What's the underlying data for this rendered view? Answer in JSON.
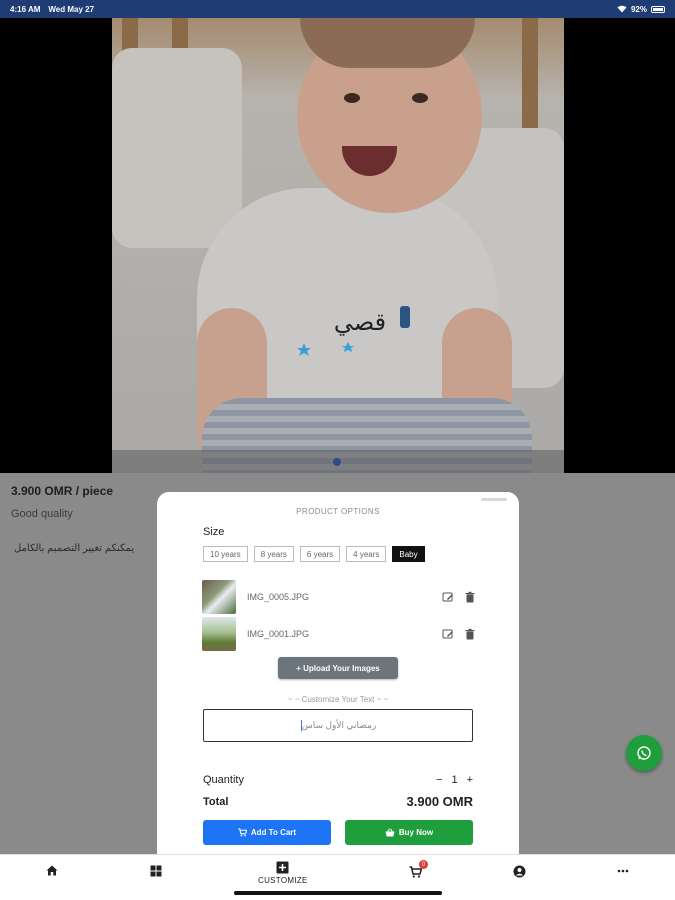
{
  "status_bar": {
    "time": "4:16 AM",
    "date": "Wed May 27",
    "battery": "92%"
  },
  "product": {
    "price": "3.900 OMR / piece",
    "quality": "Good quality",
    "note_arabic": "يمكنكم تغيير التصميم بالكامل",
    "image_text_arabic": "قصي"
  },
  "modal": {
    "title": "PRODUCT OPTIONS",
    "size_label": "Size",
    "sizes": [
      "10 years",
      "8 years",
      "6 years",
      "4 years",
      "Baby"
    ],
    "selected_size": "Baby",
    "files": [
      {
        "name": "IMG_0005.JPG"
      },
      {
        "name": "IMG_0001.JPG"
      }
    ],
    "upload_label": "+ Upload Your Images",
    "customize_label": "~ ~ Customize Your Text ~ ~",
    "custom_text_value": "رمضاني الأول ساس",
    "quantity_label": "Quantity",
    "quantity_minus": "−",
    "quantity_value": "1",
    "quantity_plus": "+",
    "total_label": "Total",
    "total_value": "3.900 OMR",
    "add_to_cart": "Add To Cart",
    "buy_now": "Buy Now"
  },
  "bottom_nav": {
    "customize_label": "CUSTOMIZE",
    "cart_badge": "0"
  },
  "colors": {
    "status_bar": "#1f3d74",
    "add_to_cart": "#1d74f5",
    "buy_now": "#1e9e3d",
    "whatsapp": "#1e9e3d"
  }
}
